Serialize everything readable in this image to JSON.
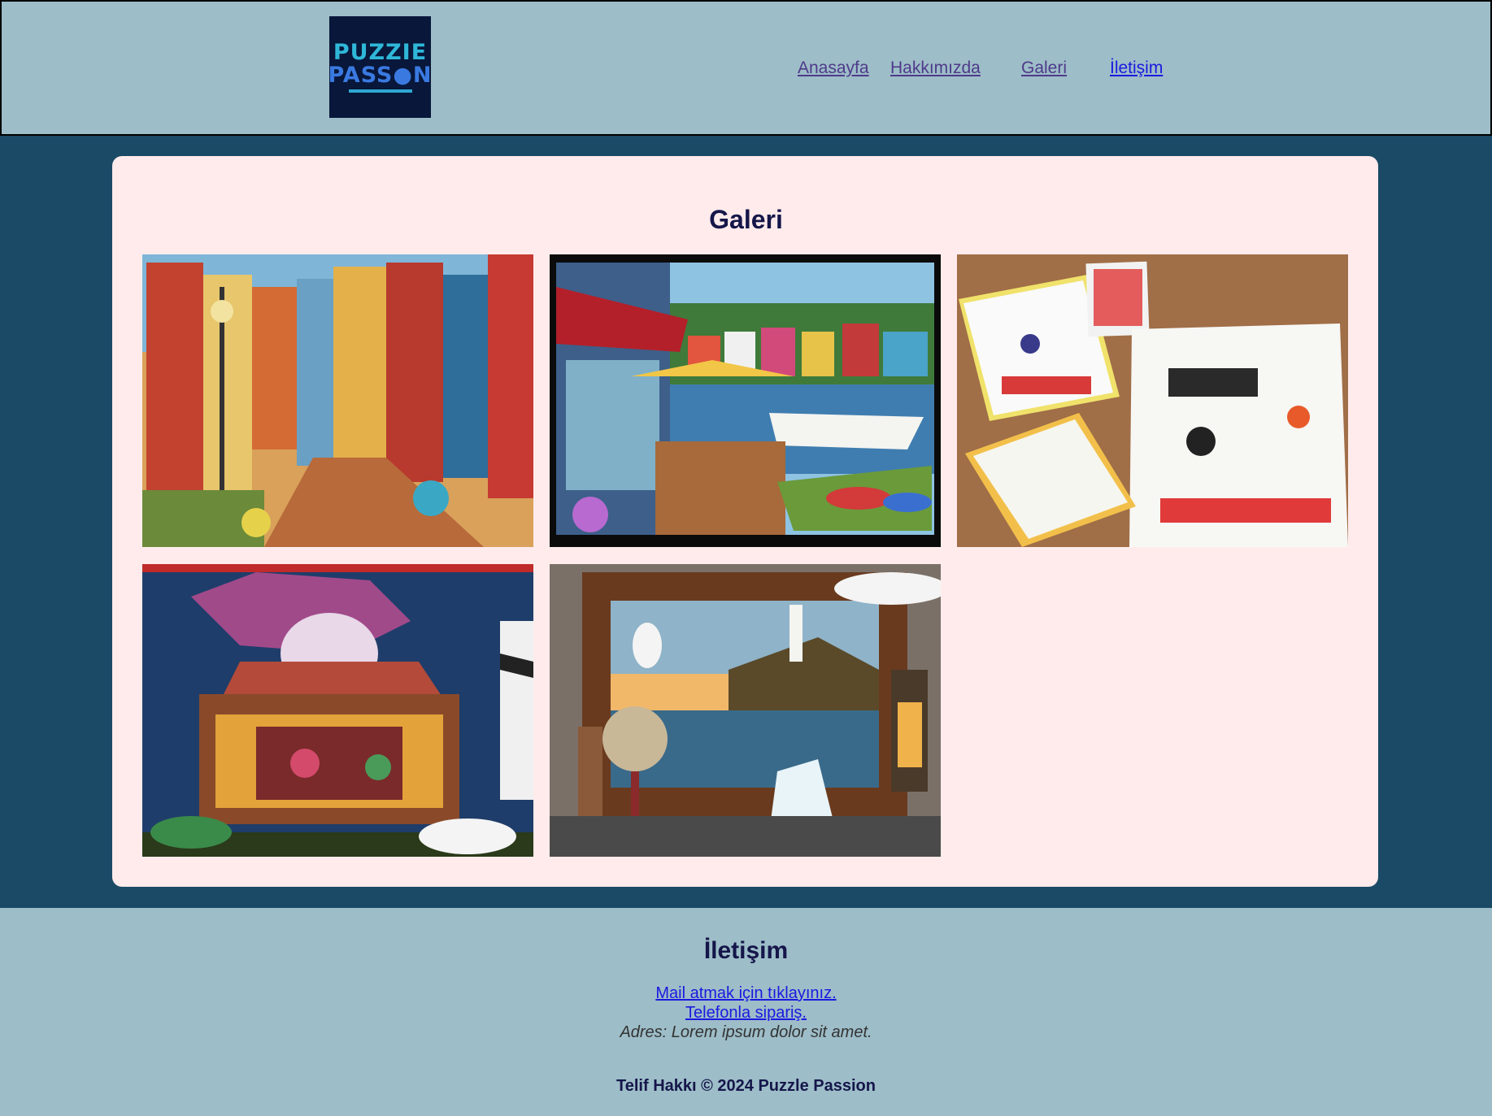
{
  "header": {
    "logo_line1": "PUZZIE",
    "logo_line2": "PASS●N",
    "nav": [
      {
        "label": "Anasayfa"
      },
      {
        "label": "Hakkımızda"
      },
      {
        "label": "Galeri"
      },
      {
        "label": "İletişim"
      }
    ]
  },
  "main": {
    "title": "Galeri",
    "photos": [
      {
        "alt": "colorful-street-puzzle"
      },
      {
        "alt": "harbor-gallery-puzzle"
      },
      {
        "alt": "how-i-met-your-mother-puzzles"
      },
      {
        "alt": "jester-music-box-puzzle"
      },
      {
        "alt": "lighthouse-frame-puzzle"
      }
    ]
  },
  "footer": {
    "title": "İletişim",
    "mail_link": "Mail atmak için tıklayınız.",
    "phone_link": "Telefonla sipariş.",
    "address": "Adres: Lorem ipsum dolor sit amet.",
    "copyright": "Telif Hakkı © 2024 Puzzle Passion"
  },
  "colors": {
    "header_bg": "#9dbdc8",
    "page_bg": "#1a4a66",
    "card_bg": "#ffebeb",
    "title_text": "#15164a",
    "link": "#1a1ae0",
    "visited_link": "#4f3a8a"
  }
}
